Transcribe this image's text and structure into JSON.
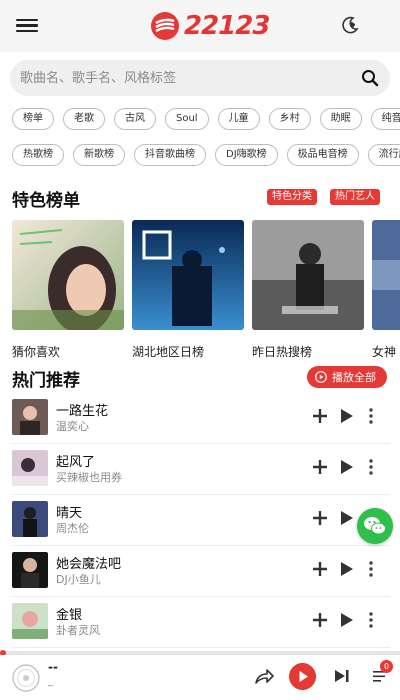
{
  "app": {
    "logo_text": "22123",
    "brand_color": "#e53935"
  },
  "search": {
    "placeholder": "歌曲名、歌手名、风格标签"
  },
  "tags_row1": [
    "榜单",
    "老歌",
    "古风",
    "Soul",
    "儿童",
    "乡村",
    "助眠",
    "纯音乐"
  ],
  "tags_row2": [
    "热歌榜",
    "新歌榜",
    "抖音歌曲榜",
    "DJ嗨歌榜",
    "极品电音榜",
    "流行趋"
  ],
  "featured": {
    "title": "特色榜单",
    "tag_categories": "特色分类",
    "tag_artists": "热门艺人",
    "cards": [
      {
        "label": "猜你喜欢"
      },
      {
        "label": "湖北地区日榜"
      },
      {
        "label": "昨日热搜榜"
      },
      {
        "label": "女神"
      }
    ]
  },
  "hot": {
    "title": "热门推荐",
    "play_all": "播放全部",
    "songs": [
      {
        "title": "一路生花",
        "artist": "温奕心"
      },
      {
        "title": "起风了",
        "artist": "买辣椒也用券"
      },
      {
        "title": "晴天",
        "artist": "周杰伦"
      },
      {
        "title": "她会魔法吧",
        "artist": "DJ小鱼儿"
      },
      {
        "title": "金银",
        "artist": "卦者灵风"
      }
    ]
  },
  "player": {
    "title": "--",
    "artist": "_",
    "queue_count": "0"
  }
}
